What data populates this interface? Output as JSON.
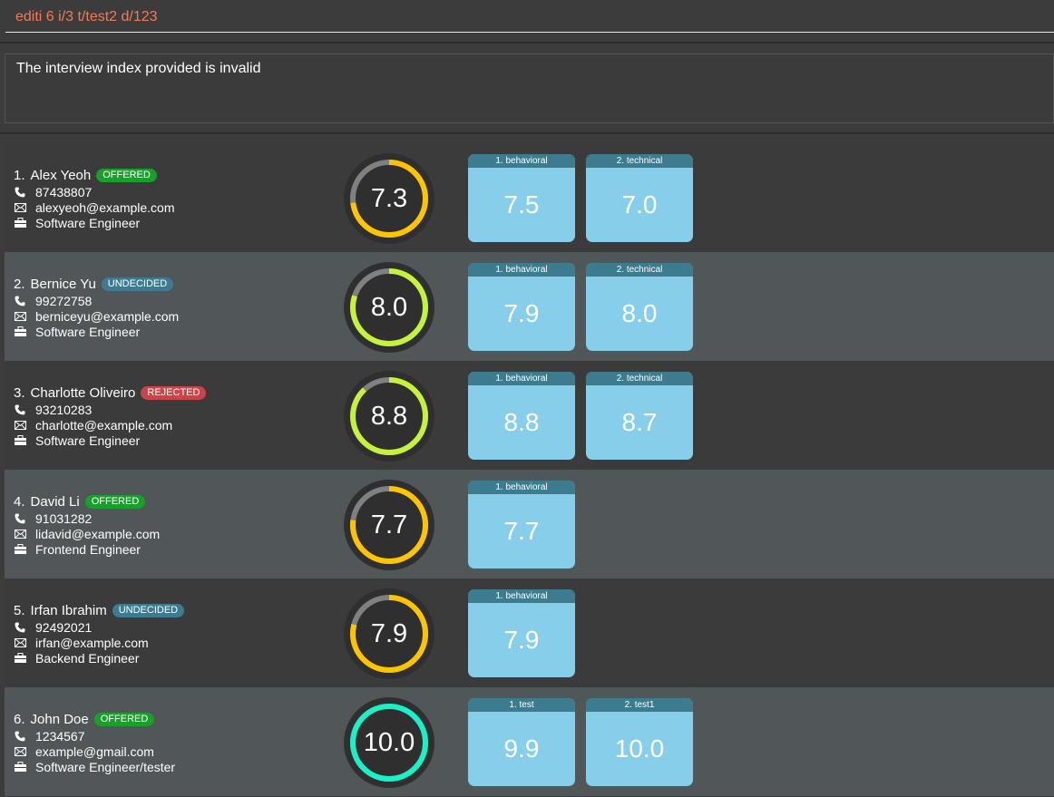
{
  "command": {
    "value": "editi 6 i/3 t/test2 d/123"
  },
  "result": {
    "message": "The interview index provided is invalid"
  },
  "icons": {
    "phone": "phone-icon",
    "email": "envelope-icon",
    "role": "briefcase-icon"
  },
  "colors": {
    "offered": "#1a9e2c",
    "undecided": "#3e7b91",
    "rejected": "#c8464a",
    "ring_yellow": "#ffc400",
    "ring_lime": "#c6f23c",
    "ring_teal": "#19f2c8",
    "ring_track": "#808080",
    "score_card": "#87ceeb",
    "score_header": "#3d7b8f"
  },
  "candidates": [
    {
      "index": "1.",
      "name": "Alex Yeoh",
      "status": "OFFERED",
      "phone": "87438807",
      "email": "alexyeoh@example.com",
      "role": "Software Engineer",
      "rating": "7.3",
      "ring_fraction": 0.73,
      "ring_color": "#ffc400",
      "scores": [
        {
          "label": "1. behavioral",
          "value": "7.5"
        },
        {
          "label": "2. technical",
          "value": "7.0"
        }
      ]
    },
    {
      "index": "2.",
      "name": "Bernice Yu",
      "status": "UNDECIDED",
      "phone": "99272758",
      "email": "berniceyu@example.com",
      "role": "Software Engineer",
      "rating": "8.0",
      "ring_fraction": 0.8,
      "ring_color": "#c6f23c",
      "scores": [
        {
          "label": "1. behavioral",
          "value": "7.9"
        },
        {
          "label": "2. technical",
          "value": "8.0"
        }
      ]
    },
    {
      "index": "3.",
      "name": "Charlotte Oliveiro",
      "status": "REJECTED",
      "phone": "93210283",
      "email": "charlotte@example.com",
      "role": "Software Engineer",
      "rating": "8.8",
      "ring_fraction": 0.88,
      "ring_color": "#c6f23c",
      "scores": [
        {
          "label": "1. behavioral",
          "value": "8.8"
        },
        {
          "label": "2. technical",
          "value": "8.7"
        }
      ]
    },
    {
      "index": "4.",
      "name": "David Li",
      "status": "OFFERED",
      "phone": "91031282",
      "email": "lidavid@example.com",
      "role": "Frontend Engineer",
      "rating": "7.7",
      "ring_fraction": 0.77,
      "ring_color": "#ffc400",
      "scores": [
        {
          "label": "1. behavioral",
          "value": "7.7"
        }
      ]
    },
    {
      "index": "5.",
      "name": "Irfan Ibrahim",
      "status": "UNDECIDED",
      "phone": "92492021",
      "email": "irfan@example.com",
      "role": "Backend Engineer",
      "rating": "7.9",
      "ring_fraction": 0.79,
      "ring_color": "#ffc400",
      "scores": [
        {
          "label": "1. behavioral",
          "value": "7.9"
        }
      ]
    },
    {
      "index": "6.",
      "name": "John Doe",
      "status": "OFFERED",
      "phone": "1234567",
      "email": "example@gmail.com",
      "role": "Software Engineer/tester",
      "rating": "10.0",
      "ring_fraction": 1.0,
      "ring_color": "#19f2c8",
      "scores": [
        {
          "label": "1. test",
          "value": "9.9"
        },
        {
          "label": "2. test1",
          "value": "10.0"
        }
      ]
    }
  ]
}
